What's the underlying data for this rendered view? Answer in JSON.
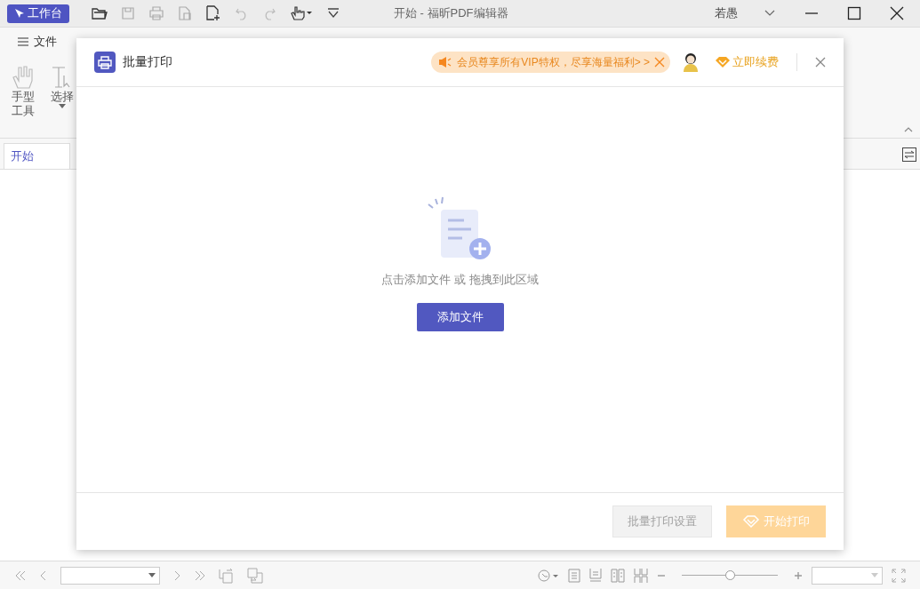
{
  "app": {
    "workbench_button": "工作台",
    "title": "开始 - 福昕PDF编辑器",
    "user": "若愚"
  },
  "menu": {
    "file": "文件"
  },
  "ribbon": [
    {
      "kind": "hand",
      "label": "手型工具"
    },
    {
      "kind": "select",
      "label": "选择"
    }
  ],
  "panel_tab": "开始",
  "dialog": {
    "title": "批量打印",
    "promo": "会员尊享所有VIP特权，尽享海量福利> >",
    "renew": "立即续费",
    "drop_hint": "点击添加文件 或 拖拽到此区域",
    "add_button": "添加文件",
    "settings_button": {
      "label": "批量打印设置",
      "disabled": true
    },
    "start_button": {
      "label": "开始打印",
      "disabled": true
    }
  },
  "status_bar": {
    "zoom": {
      "level": 0.5
    }
  }
}
